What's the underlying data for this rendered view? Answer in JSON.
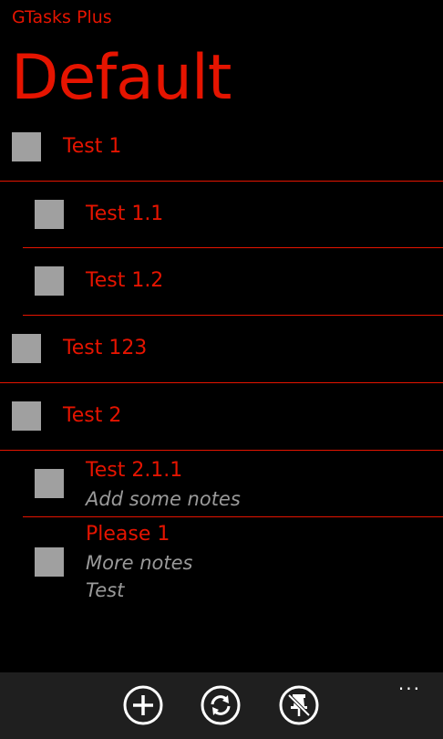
{
  "app": {
    "title": "GTasks Plus"
  },
  "page": {
    "title": "Default"
  },
  "tasks": [
    {
      "label": "Test 1",
      "checked": false,
      "indent": 0
    },
    {
      "label": "Test 1.1",
      "checked": false,
      "indent": 1
    },
    {
      "label": "Test 1.2",
      "checked": false,
      "indent": 1
    },
    {
      "label": "Test 123",
      "checked": false,
      "indent": 0
    },
    {
      "label": "Test 2",
      "checked": false,
      "indent": 0
    },
    {
      "label": "Test 2.1.1",
      "checked": false,
      "indent": 1,
      "notes": [
        "Add some notes"
      ]
    },
    {
      "label": "Please 1",
      "checked": false,
      "indent": 1,
      "notes": [
        "More notes",
        "Test"
      ]
    }
  ],
  "appbar": {
    "buttons": [
      {
        "icon": "add-icon"
      },
      {
        "icon": "sync-icon"
      },
      {
        "icon": "pin-icon"
      }
    ],
    "more": "..."
  },
  "colors": {
    "accent": "#e51400",
    "background": "#000000",
    "checkbox": "#a0a0a0",
    "appbar": "#1f1f1f",
    "note": "#9a9a9a"
  }
}
